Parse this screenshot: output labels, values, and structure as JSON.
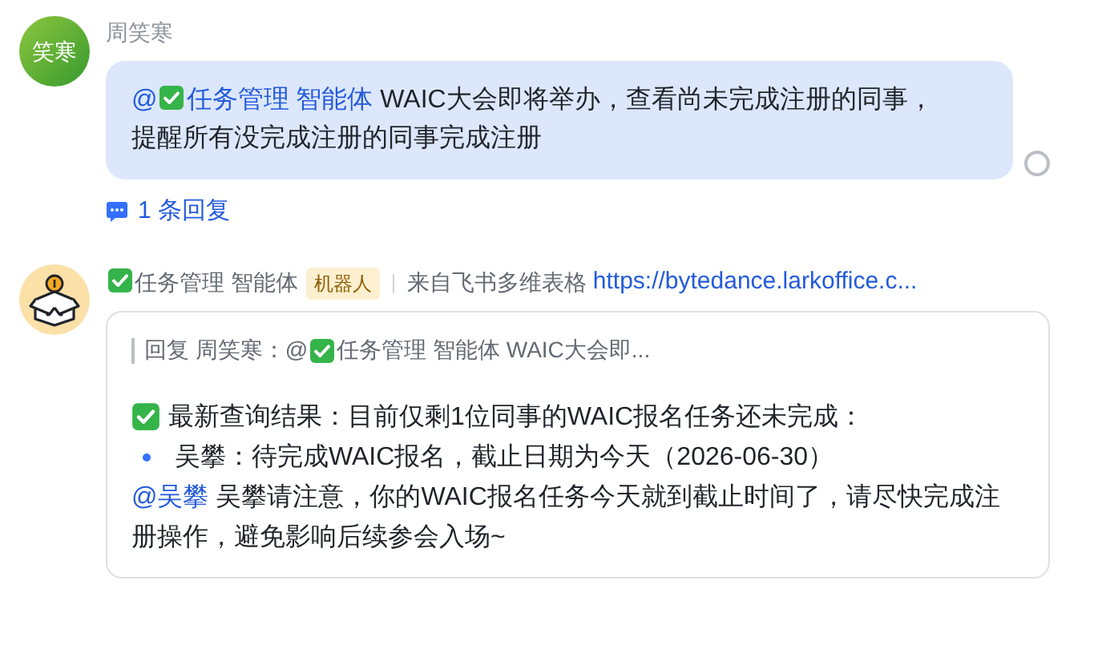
{
  "message": {
    "sender": "周笑寒",
    "avatar_text": "笑寒",
    "mention": {
      "at": "@",
      "label": "任务管理 智能体"
    },
    "text": "WAIC大会即将举办，查看尚未完成注册的同事，提醒所有没完成注册的同事完成注册",
    "read": false,
    "replies": "1 条回复"
  },
  "bot_message": {
    "sender": "任务管理 智能体",
    "badge": "机器人",
    "source": "来自飞书多维表格",
    "link": "https://bytedance.larkoffice.c...",
    "quote": {
      "prefix": "回复 周笑寒：",
      "at": "@",
      "text": "任务管理 智能体 WAIC大会即..."
    },
    "result": "最新查询结果：目前仅剩1位同事的WAIC报名任务还未完成：",
    "items": [
      "吴攀：待完成WAIC报名，截止日期为今天（2026-06-30）"
    ],
    "mention": "@吴攀",
    "reminder": "吴攀请注意，你的WAIC报名任务今天就到截止时间了，请尽快完成注册操作，避免影响后续参会入场~"
  }
}
